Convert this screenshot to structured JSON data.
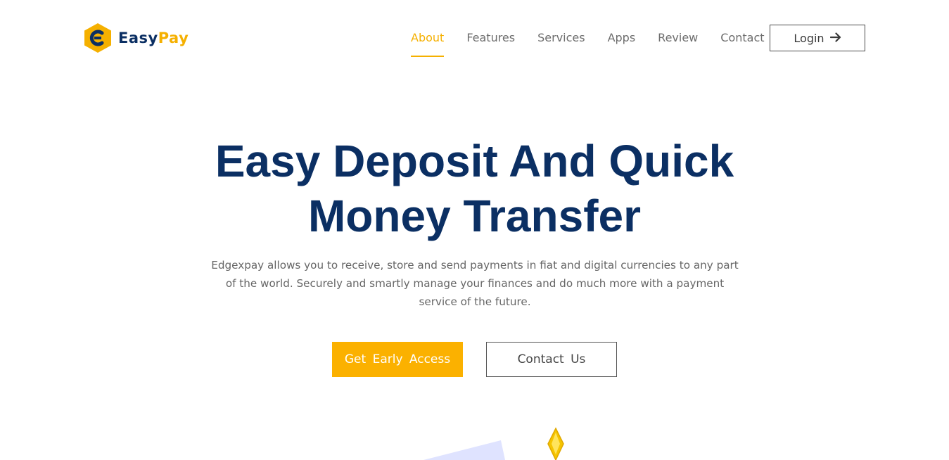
{
  "header": {
    "brand": {
      "part1": "Easy",
      "part2": "Pay"
    },
    "nav": [
      {
        "label": "About",
        "active": true
      },
      {
        "label": "Features",
        "active": false
      },
      {
        "label": "Services",
        "active": false
      },
      {
        "label": "Apps",
        "active": false
      },
      {
        "label": "Review",
        "active": false
      },
      {
        "label": "Contact",
        "active": false
      }
    ],
    "login_label": "Login",
    "login_icon": "arrow-right-icon"
  },
  "hero": {
    "title_line1": "Easy Deposit And Quick",
    "title_line2": "Money Transfer",
    "description": "Edgexpay allows you to receive, store and send payments in fiat and digital currencies to any part of the world. Securely and smartly manage your finances and do much more with a payment service of the future.",
    "primary_button": "Get  Early  Access",
    "secondary_button": "Contact  Us"
  },
  "colors": {
    "brand_navy": "#0b2f63",
    "brand_yellow": "#f5b000",
    "text_gray": "#666666"
  }
}
